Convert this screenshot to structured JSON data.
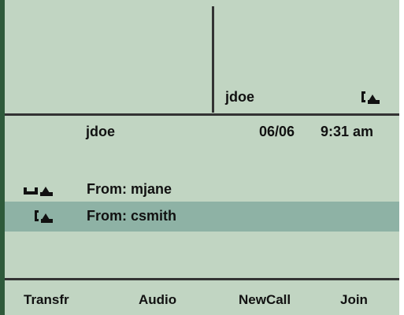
{
  "ident_panel": {
    "user": "jdoe",
    "line_icon": "phone-offhook-icon"
  },
  "status_bar": {
    "user": "jdoe",
    "date": "06/06",
    "time": "9:31 am"
  },
  "calls": [
    {
      "label": "From: mjane",
      "icon": "phone-onhook-icon",
      "selected": false
    },
    {
      "label": "From: csmith",
      "icon": "phone-offhook-icon",
      "selected": true
    }
  ],
  "softkeys": [
    "Transfr",
    "Audio",
    "NewCall",
    "Join"
  ],
  "colors": {
    "screen_bg": "#c1d5c2",
    "selected_row": "#8eb2a5",
    "frame": "#2e5a3a"
  }
}
